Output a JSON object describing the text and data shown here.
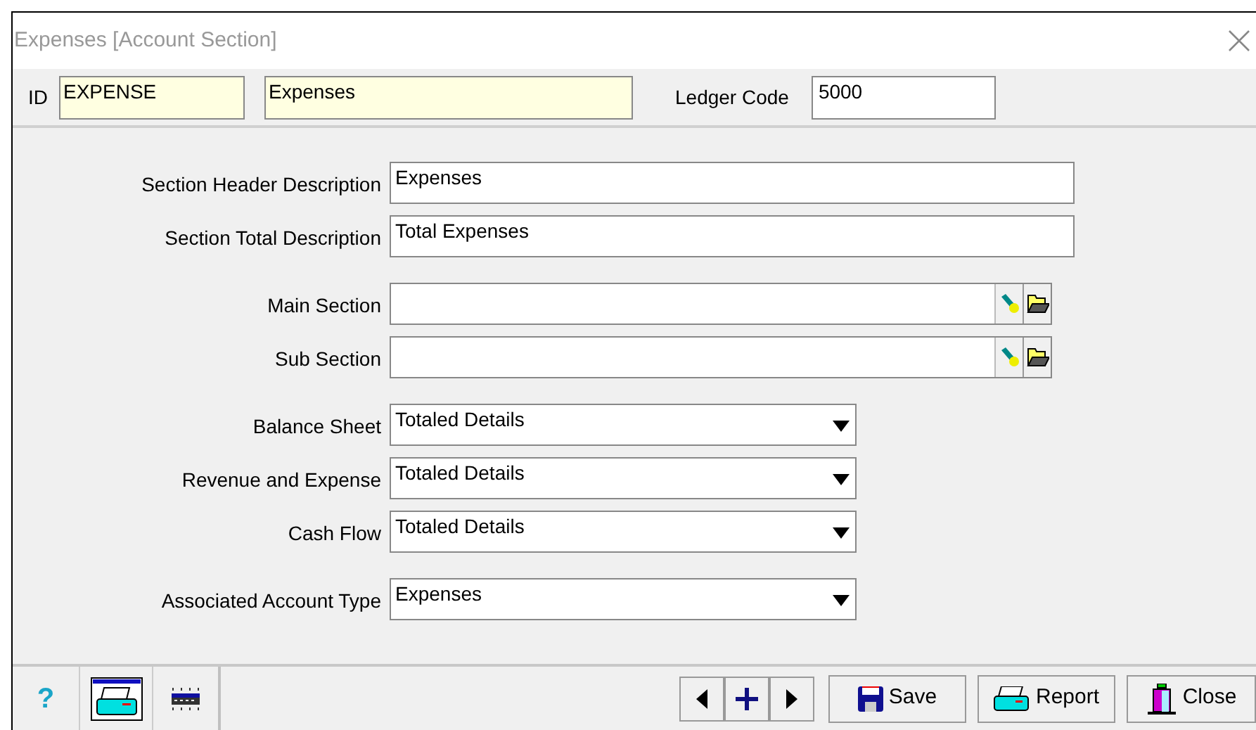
{
  "window": {
    "title": "Expenses  [Account Section]"
  },
  "header": {
    "id_label": "ID",
    "id_value": "EXPENSE",
    "name_value": "Expenses",
    "ledger_label": "Ledger Code",
    "ledger_value": "5000"
  },
  "field_groups": [
    [
      {
        "kind": "text",
        "label": "Section Header Description",
        "value": "Expenses"
      },
      {
        "kind": "text",
        "label": "Section Total Description",
        "value": "Total Expenses"
      }
    ],
    [
      {
        "kind": "lookup",
        "label": "Main Section"
      },
      {
        "kind": "lookup",
        "label": "Sub Section"
      }
    ],
    [
      {
        "kind": "select",
        "label": "Balance Sheet",
        "value": "Totaled Details"
      },
      {
        "kind": "select",
        "label": "Revenue and Expense",
        "value": "Totaled Details"
      },
      {
        "kind": "select",
        "label": "Cash Flow",
        "value": "Totaled Details"
      }
    ],
    [
      {
        "kind": "select",
        "label": "Associated Account Type",
        "value": "Expenses"
      }
    ]
  ],
  "footer": {
    "help": "?",
    "buttons": [
      {
        "kind": "save",
        "label": "Save"
      },
      {
        "kind": "report",
        "label": "Report"
      },
      {
        "kind": "close",
        "label": "Close"
      }
    ]
  }
}
